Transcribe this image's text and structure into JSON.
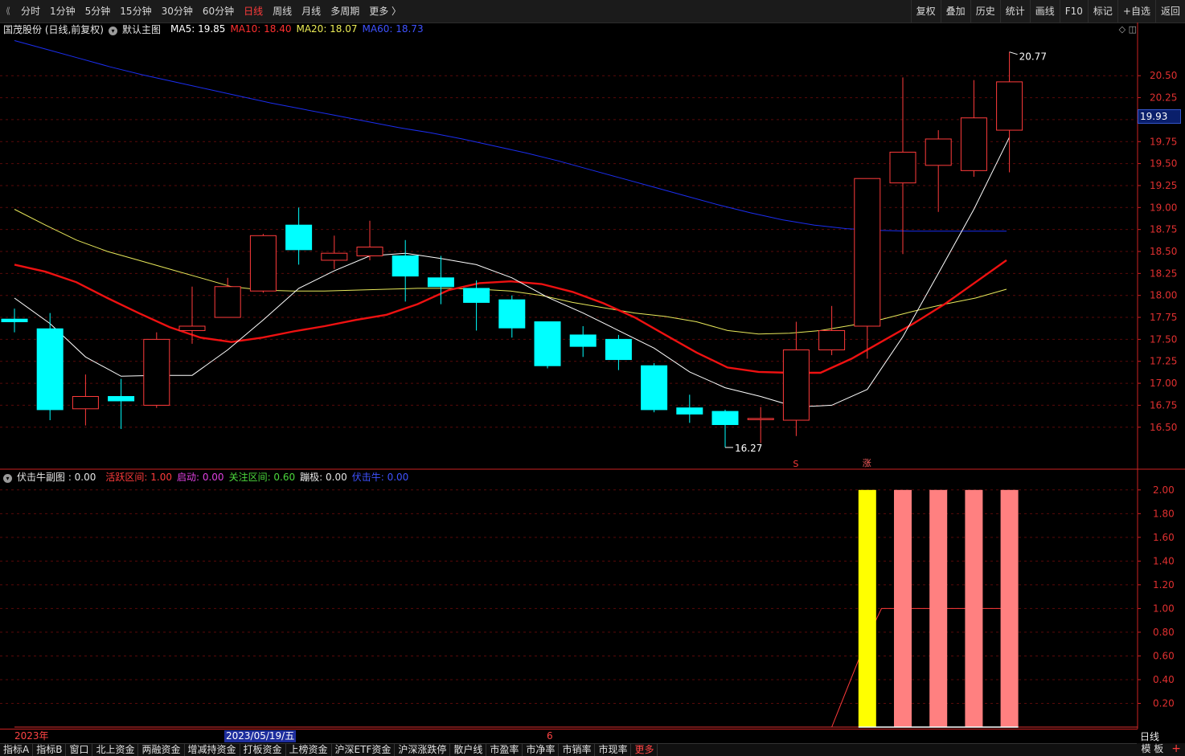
{
  "toolbar": {
    "periods": [
      {
        "label": "分时",
        "active": false
      },
      {
        "label": "1分钟",
        "active": false
      },
      {
        "label": "5分钟",
        "active": false
      },
      {
        "label": "15分钟",
        "active": false
      },
      {
        "label": "30分钟",
        "active": false
      },
      {
        "label": "60分钟",
        "active": false
      },
      {
        "label": "日线",
        "active": true
      },
      {
        "label": "周线",
        "active": false
      },
      {
        "label": "月线",
        "active": false
      },
      {
        "label": "多周期",
        "active": false
      },
      {
        "label": "更多 〉",
        "active": false
      }
    ],
    "tools": [
      "复权",
      "叠加",
      "历史",
      "统计",
      "画线",
      "F10",
      "标记",
      "+自选",
      "返回"
    ]
  },
  "main_legend": {
    "stock": "国茂股份 (日线,前复权)",
    "template": "默认主图",
    "ma5": "MA5: 19.85",
    "ma10": "MA10: 18.40",
    "ma20": "MA20: 18.07",
    "ma60": "MA60: 18.73"
  },
  "sub_legend": {
    "name": "伏击牛副图 : 0.00",
    "active_zone": "活跃区间: 1.00",
    "start": "启动: 0.00",
    "watch_zone": "关注区间: 0.60",
    "limit": "蹦极: 0.00",
    "ambush": "伏击牛: 0.00"
  },
  "colors": {
    "up": "#ff3b3b",
    "down": "#00ffff",
    "ma5": "#ffffff",
    "ma10": "#ee1111",
    "ma20": "#e8e85a",
    "ma60": "#1b2ef0",
    "axis": "#c22",
    "sub_yellow": "#ffff00",
    "sub_pink": "#ff8080"
  },
  "last_price_tag": "19.93",
  "markers": {
    "high_label": "20.77",
    "low_label": "16.27",
    "signal_s": "S",
    "signal_zhang": "涨"
  },
  "date_bar": {
    "year": "2023年",
    "cursor_date": "2023/05/19/五",
    "month": "6",
    "period_label": "日线"
  },
  "bottom_bar": {
    "items": [
      "指标A",
      "指标B",
      "窗口",
      "北上资金",
      "两融资金",
      "增减持资金",
      "打板资金",
      "上榜资金",
      "沪深ETF资金",
      "沪深涨跌停",
      "散户线",
      "市盈率",
      "市净率",
      "市销率",
      "市现率",
      "更多"
    ],
    "right": [
      "模 板",
      "+"
    ]
  },
  "chart_data": [
    {
      "type": "candlestick",
      "title": "国茂股份 (日线,前复权)",
      "y_ticks": [
        16.5,
        16.75,
        17.0,
        17.25,
        17.5,
        17.75,
        18.0,
        18.25,
        18.5,
        18.75,
        19.0,
        19.25,
        19.5,
        19.75,
        20.0,
        20.25,
        20.5
      ],
      "ylim": [
        16.05,
        20.95
      ],
      "candles": [
        {
          "o": 17.73,
          "h": 17.85,
          "l": 17.58,
          "c": 17.7
        },
        {
          "o": 17.62,
          "h": 17.8,
          "l": 16.58,
          "c": 16.7
        },
        {
          "o": 16.71,
          "h": 17.1,
          "l": 16.52,
          "c": 16.85
        },
        {
          "o": 16.85,
          "h": 17.05,
          "l": 16.48,
          "c": 16.8
        },
        {
          "o": 16.75,
          "h": 17.58,
          "l": 16.72,
          "c": 17.5
        },
        {
          "o": 17.6,
          "h": 18.1,
          "l": 17.45,
          "c": 17.65
        },
        {
          "o": 17.75,
          "h": 18.2,
          "l": 17.75,
          "c": 18.1
        },
        {
          "o": 18.05,
          "h": 18.7,
          "l": 18.03,
          "c": 18.68
        },
        {
          "o": 18.8,
          "h": 19.0,
          "l": 18.35,
          "c": 18.52
        },
        {
          "o": 18.4,
          "h": 18.68,
          "l": 18.3,
          "c": 18.48
        },
        {
          "o": 18.45,
          "h": 18.85,
          "l": 18.4,
          "c": 18.55
        },
        {
          "o": 18.45,
          "h": 18.63,
          "l": 17.93,
          "c": 18.22
        },
        {
          "o": 18.2,
          "h": 18.45,
          "l": 17.9,
          "c": 18.1
        },
        {
          "o": 18.08,
          "h": 18.17,
          "l": 17.6,
          "c": 17.92
        },
        {
          "o": 17.95,
          "h": 18.0,
          "l": 17.52,
          "c": 17.63
        },
        {
          "o": 17.7,
          "h": 17.7,
          "l": 17.17,
          "c": 17.2
        },
        {
          "o": 17.55,
          "h": 17.65,
          "l": 17.3,
          "c": 17.42
        },
        {
          "o": 17.5,
          "h": 17.55,
          "l": 17.15,
          "c": 17.27
        },
        {
          "o": 17.2,
          "h": 17.23,
          "l": 16.67,
          "c": 16.7
        },
        {
          "o": 16.72,
          "h": 16.87,
          "l": 16.55,
          "c": 16.65
        },
        {
          "o": 16.68,
          "h": 16.7,
          "l": 16.27,
          "c": 16.53
        },
        {
          "o": 16.6,
          "h": 16.73,
          "l": 16.32,
          "c": 16.6
        },
        {
          "o": 16.58,
          "h": 17.7,
          "l": 16.4,
          "c": 17.38
        },
        {
          "o": 17.38,
          "h": 17.88,
          "l": 17.32,
          "c": 17.6
        },
        {
          "o": 17.65,
          "h": 19.33,
          "l": 17.28,
          "c": 19.33
        },
        {
          "o": 19.28,
          "h": 20.48,
          "l": 18.47,
          "c": 19.63
        },
        {
          "o": 19.48,
          "h": 19.88,
          "l": 18.95,
          "c": 19.78
        },
        {
          "o": 19.42,
          "h": 20.45,
          "l": 19.35,
          "c": 20.02
        },
        {
          "o": 19.88,
          "h": 20.77,
          "l": 19.4,
          "c": 20.43
        }
      ],
      "ma5": [
        17.97,
        17.68,
        17.3,
        17.08,
        17.09,
        17.09,
        17.38,
        17.72,
        18.08,
        18.28,
        18.45,
        18.48,
        18.42,
        18.35,
        18.2,
        17.98,
        17.8,
        17.6,
        17.4,
        17.13,
        16.95,
        16.85,
        16.73,
        16.75,
        16.93,
        17.53,
        18.25,
        18.98,
        19.8
      ],
      "ma10": [
        18.35,
        18.27,
        18.15,
        17.97,
        17.8,
        17.64,
        17.52,
        17.47,
        17.52,
        17.59,
        17.65,
        17.72,
        17.78,
        17.9,
        18.06,
        18.14,
        18.16,
        18.13,
        18.04,
        17.91,
        17.75,
        17.55,
        17.35,
        17.18,
        17.13,
        17.12,
        17.12,
        17.28,
        17.48,
        17.68,
        17.9,
        18.15,
        18.4
      ]
    },
    {
      "type": "bar",
      "title": "伏击牛副图",
      "y_ticks": [
        0.2,
        0.4,
        0.6,
        0.8,
        1.0,
        1.2,
        1.4,
        1.6,
        1.8,
        2.0
      ],
      "ylim": [
        0,
        2.08
      ],
      "bars": [
        {
          "index": 24,
          "value": 2.0,
          "series": "启动"
        },
        {
          "index": 25,
          "value": 2.0,
          "series": "活跃区间"
        },
        {
          "index": 26,
          "value": 2.0,
          "series": "活跃区间"
        },
        {
          "index": 27,
          "value": 2.0,
          "series": "活跃区间"
        },
        {
          "index": 28,
          "value": 2.0,
          "series": "活跃区间"
        }
      ],
      "line_points": [
        {
          "index": 23,
          "value": 0.0
        },
        {
          "index": 24,
          "value": 0.75
        },
        {
          "index": 24.4,
          "value": 1.0
        },
        {
          "index": 28,
          "value": 1.0
        }
      ]
    }
  ]
}
